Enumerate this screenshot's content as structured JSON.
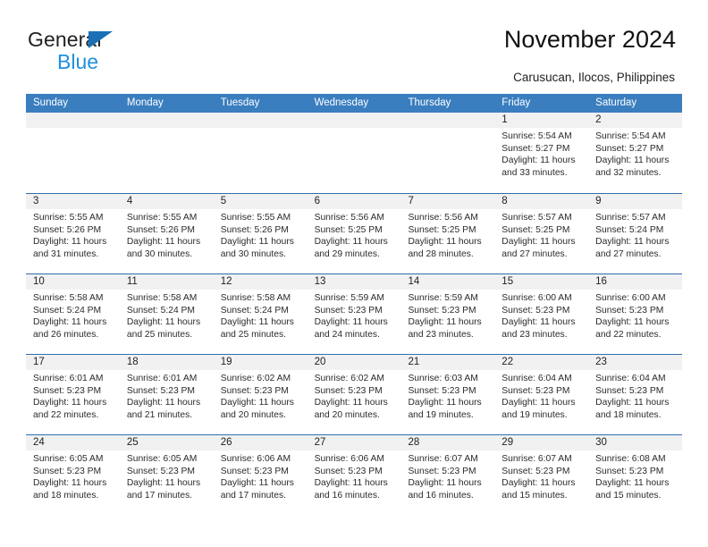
{
  "brand": {
    "name_top": "General",
    "name_bottom": "Blue",
    "accent_color": "#1a6fb5",
    "accent_color_light": "#1f8fe0"
  },
  "header": {
    "title": "November 2024",
    "subtitle": "Carusucan, Ilocos, Philippines"
  },
  "calendar": {
    "header_bg": "#3a7ebf",
    "weekdays": [
      "Sunday",
      "Monday",
      "Tuesday",
      "Wednesday",
      "Thursday",
      "Friday",
      "Saturday"
    ],
    "weeks": [
      [
        {
          "date": "",
          "sunrise": "",
          "sunset": "",
          "daylight": ""
        },
        {
          "date": "",
          "sunrise": "",
          "sunset": "",
          "daylight": ""
        },
        {
          "date": "",
          "sunrise": "",
          "sunset": "",
          "daylight": ""
        },
        {
          "date": "",
          "sunrise": "",
          "sunset": "",
          "daylight": ""
        },
        {
          "date": "",
          "sunrise": "",
          "sunset": "",
          "daylight": ""
        },
        {
          "date": "1",
          "sunrise": "Sunrise: 5:54 AM",
          "sunset": "Sunset: 5:27 PM",
          "daylight": "Daylight: 11 hours and 33 minutes."
        },
        {
          "date": "2",
          "sunrise": "Sunrise: 5:54 AM",
          "sunset": "Sunset: 5:27 PM",
          "daylight": "Daylight: 11 hours and 32 minutes."
        }
      ],
      [
        {
          "date": "3",
          "sunrise": "Sunrise: 5:55 AM",
          "sunset": "Sunset: 5:26 PM",
          "daylight": "Daylight: 11 hours and 31 minutes."
        },
        {
          "date": "4",
          "sunrise": "Sunrise: 5:55 AM",
          "sunset": "Sunset: 5:26 PM",
          "daylight": "Daylight: 11 hours and 30 minutes."
        },
        {
          "date": "5",
          "sunrise": "Sunrise: 5:55 AM",
          "sunset": "Sunset: 5:26 PM",
          "daylight": "Daylight: 11 hours and 30 minutes."
        },
        {
          "date": "6",
          "sunrise": "Sunrise: 5:56 AM",
          "sunset": "Sunset: 5:25 PM",
          "daylight": "Daylight: 11 hours and 29 minutes."
        },
        {
          "date": "7",
          "sunrise": "Sunrise: 5:56 AM",
          "sunset": "Sunset: 5:25 PM",
          "daylight": "Daylight: 11 hours and 28 minutes."
        },
        {
          "date": "8",
          "sunrise": "Sunrise: 5:57 AM",
          "sunset": "Sunset: 5:25 PM",
          "daylight": "Daylight: 11 hours and 27 minutes."
        },
        {
          "date": "9",
          "sunrise": "Sunrise: 5:57 AM",
          "sunset": "Sunset: 5:24 PM",
          "daylight": "Daylight: 11 hours and 27 minutes."
        }
      ],
      [
        {
          "date": "10",
          "sunrise": "Sunrise: 5:58 AM",
          "sunset": "Sunset: 5:24 PM",
          "daylight": "Daylight: 11 hours and 26 minutes."
        },
        {
          "date": "11",
          "sunrise": "Sunrise: 5:58 AM",
          "sunset": "Sunset: 5:24 PM",
          "daylight": "Daylight: 11 hours and 25 minutes."
        },
        {
          "date": "12",
          "sunrise": "Sunrise: 5:58 AM",
          "sunset": "Sunset: 5:24 PM",
          "daylight": "Daylight: 11 hours and 25 minutes."
        },
        {
          "date": "13",
          "sunrise": "Sunrise: 5:59 AM",
          "sunset": "Sunset: 5:23 PM",
          "daylight": "Daylight: 11 hours and 24 minutes."
        },
        {
          "date": "14",
          "sunrise": "Sunrise: 5:59 AM",
          "sunset": "Sunset: 5:23 PM",
          "daylight": "Daylight: 11 hours and 23 minutes."
        },
        {
          "date": "15",
          "sunrise": "Sunrise: 6:00 AM",
          "sunset": "Sunset: 5:23 PM",
          "daylight": "Daylight: 11 hours and 23 minutes."
        },
        {
          "date": "16",
          "sunrise": "Sunrise: 6:00 AM",
          "sunset": "Sunset: 5:23 PM",
          "daylight": "Daylight: 11 hours and 22 minutes."
        }
      ],
      [
        {
          "date": "17",
          "sunrise": "Sunrise: 6:01 AM",
          "sunset": "Sunset: 5:23 PM",
          "daylight": "Daylight: 11 hours and 22 minutes."
        },
        {
          "date": "18",
          "sunrise": "Sunrise: 6:01 AM",
          "sunset": "Sunset: 5:23 PM",
          "daylight": "Daylight: 11 hours and 21 minutes."
        },
        {
          "date": "19",
          "sunrise": "Sunrise: 6:02 AM",
          "sunset": "Sunset: 5:23 PM",
          "daylight": "Daylight: 11 hours and 20 minutes."
        },
        {
          "date": "20",
          "sunrise": "Sunrise: 6:02 AM",
          "sunset": "Sunset: 5:23 PM",
          "daylight": "Daylight: 11 hours and 20 minutes."
        },
        {
          "date": "21",
          "sunrise": "Sunrise: 6:03 AM",
          "sunset": "Sunset: 5:23 PM",
          "daylight": "Daylight: 11 hours and 19 minutes."
        },
        {
          "date": "22",
          "sunrise": "Sunrise: 6:04 AM",
          "sunset": "Sunset: 5:23 PM",
          "daylight": "Daylight: 11 hours and 19 minutes."
        },
        {
          "date": "23",
          "sunrise": "Sunrise: 6:04 AM",
          "sunset": "Sunset: 5:23 PM",
          "daylight": "Daylight: 11 hours and 18 minutes."
        }
      ],
      [
        {
          "date": "24",
          "sunrise": "Sunrise: 6:05 AM",
          "sunset": "Sunset: 5:23 PM",
          "daylight": "Daylight: 11 hours and 18 minutes."
        },
        {
          "date": "25",
          "sunrise": "Sunrise: 6:05 AM",
          "sunset": "Sunset: 5:23 PM",
          "daylight": "Daylight: 11 hours and 17 minutes."
        },
        {
          "date": "26",
          "sunrise": "Sunrise: 6:06 AM",
          "sunset": "Sunset: 5:23 PM",
          "daylight": "Daylight: 11 hours and 17 minutes."
        },
        {
          "date": "27",
          "sunrise": "Sunrise: 6:06 AM",
          "sunset": "Sunset: 5:23 PM",
          "daylight": "Daylight: 11 hours and 16 minutes."
        },
        {
          "date": "28",
          "sunrise": "Sunrise: 6:07 AM",
          "sunset": "Sunset: 5:23 PM",
          "daylight": "Daylight: 11 hours and 16 minutes."
        },
        {
          "date": "29",
          "sunrise": "Sunrise: 6:07 AM",
          "sunset": "Sunset: 5:23 PM",
          "daylight": "Daylight: 11 hours and 15 minutes."
        },
        {
          "date": "30",
          "sunrise": "Sunrise: 6:08 AM",
          "sunset": "Sunset: 5:23 PM",
          "daylight": "Daylight: 11 hours and 15 minutes."
        }
      ]
    ]
  }
}
